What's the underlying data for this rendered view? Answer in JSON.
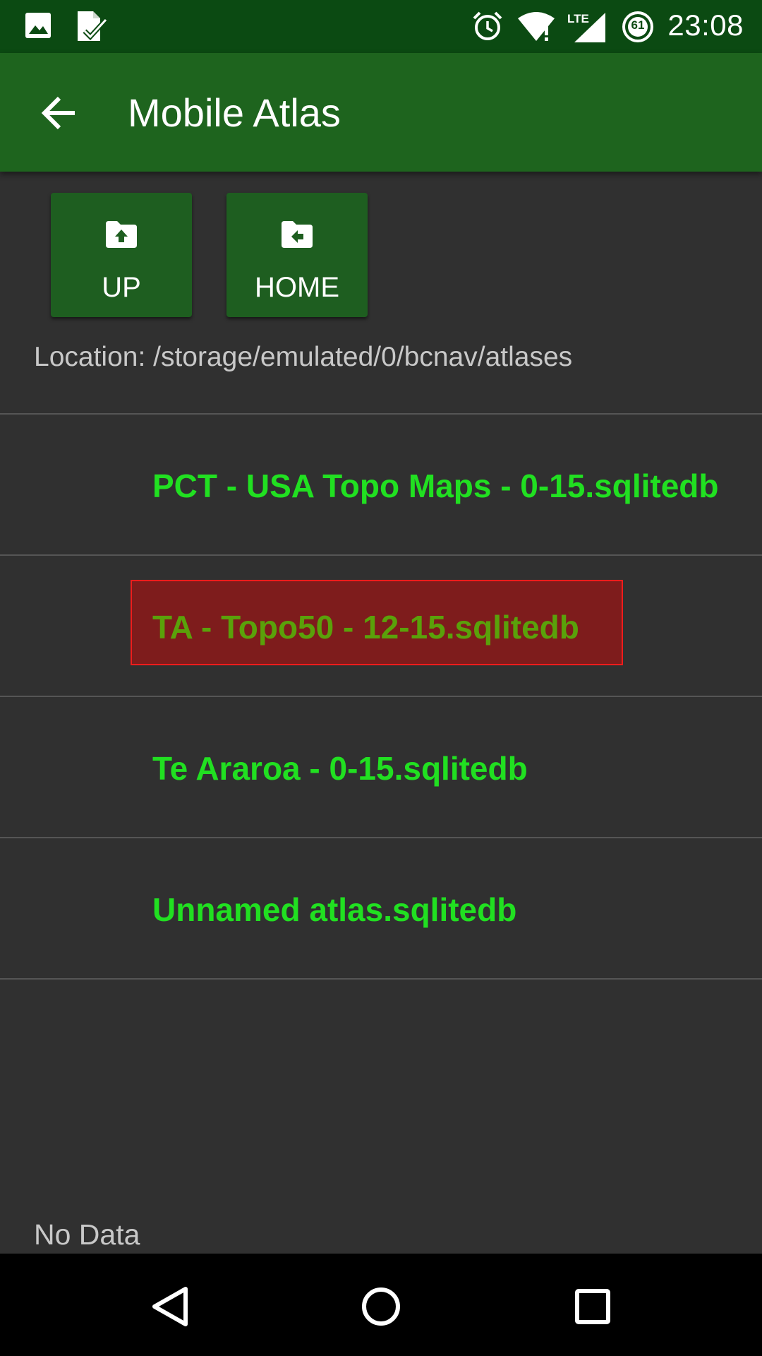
{
  "status_bar": {
    "time": "23:08",
    "battery_level": "61",
    "network_label": "LTE",
    "left_icons": [
      "image-icon",
      "task-check-icon"
    ],
    "right_icons": [
      "alarm-icon",
      "wifi-alert-icon",
      "lte-signal-icon",
      "battery-saver-icon"
    ]
  },
  "app_bar": {
    "title": "Mobile Atlas",
    "back_icon": "arrow-back-icon"
  },
  "toolbar": {
    "up_label": "UP",
    "home_label": "HOME"
  },
  "location": {
    "text": "Location: /storage/emulated/0/bcnav/atlases"
  },
  "files": [
    {
      "name": "PCT - USA Topo Maps - 0-15.sqlitedb",
      "selected": false
    },
    {
      "name": "TA - Topo50 - 12-15.sqlitedb",
      "selected": true
    },
    {
      "name": "Te Araroa - 0-15.sqlitedb",
      "selected": false
    },
    {
      "name": "Unnamed atlas.sqlitedb",
      "selected": false
    }
  ],
  "footer": {
    "status_text": "No Data"
  },
  "system_nav": {
    "buttons": [
      "back-triangle-icon",
      "home-circle-icon",
      "recents-square-icon"
    ]
  },
  "colors": {
    "status_bar": "#0b4a12",
    "app_bar": "#1e641e",
    "button": "#1e5e20",
    "background": "#303030",
    "file_text": "#21e021",
    "selected_bg": "#7e1c1c",
    "selected_border": "#ee1c1c",
    "selected_text": "#5aa10a"
  }
}
